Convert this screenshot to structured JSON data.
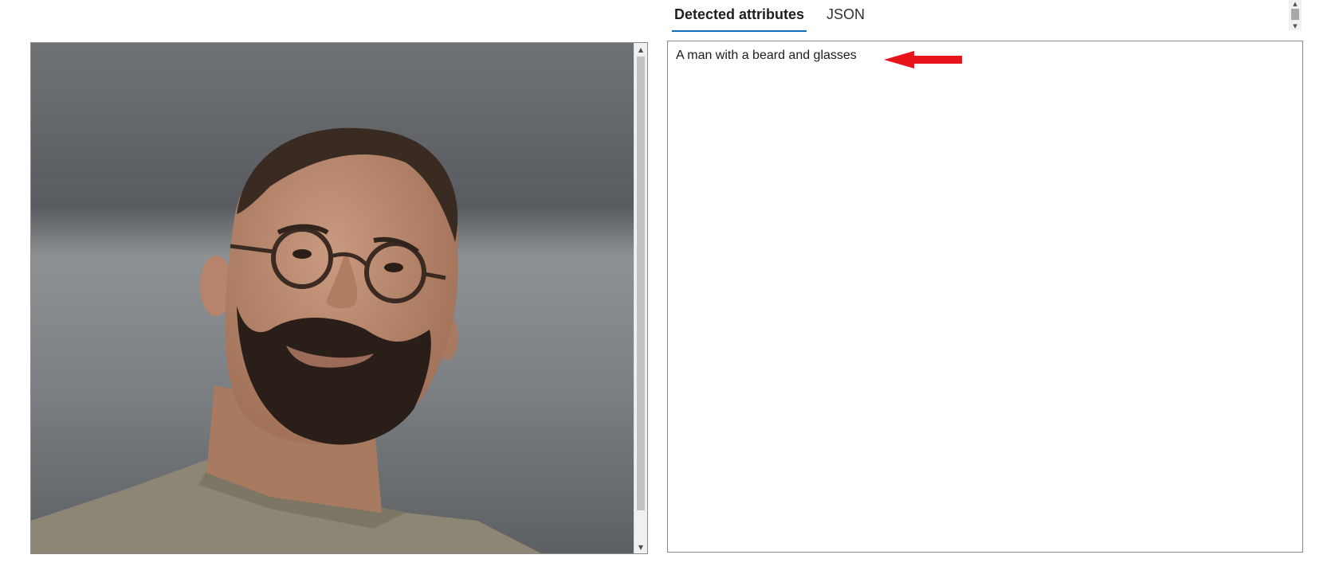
{
  "tabs": [
    {
      "label": "Detected attributes",
      "active": true
    },
    {
      "label": "JSON",
      "active": false
    }
  ],
  "image": {
    "subject": "photo-of-person"
  },
  "result": {
    "caption": "A man with a beard and glasses"
  },
  "colors": {
    "accent": "#0f6cbd",
    "annotation_arrow": "#e8141c",
    "border": "#8a8a8a"
  },
  "icons": {
    "annotation": "red-arrow-left-icon",
    "scroll_up": "scroll-up-arrow-icon",
    "scroll_down": "scroll-down-arrow-icon"
  }
}
